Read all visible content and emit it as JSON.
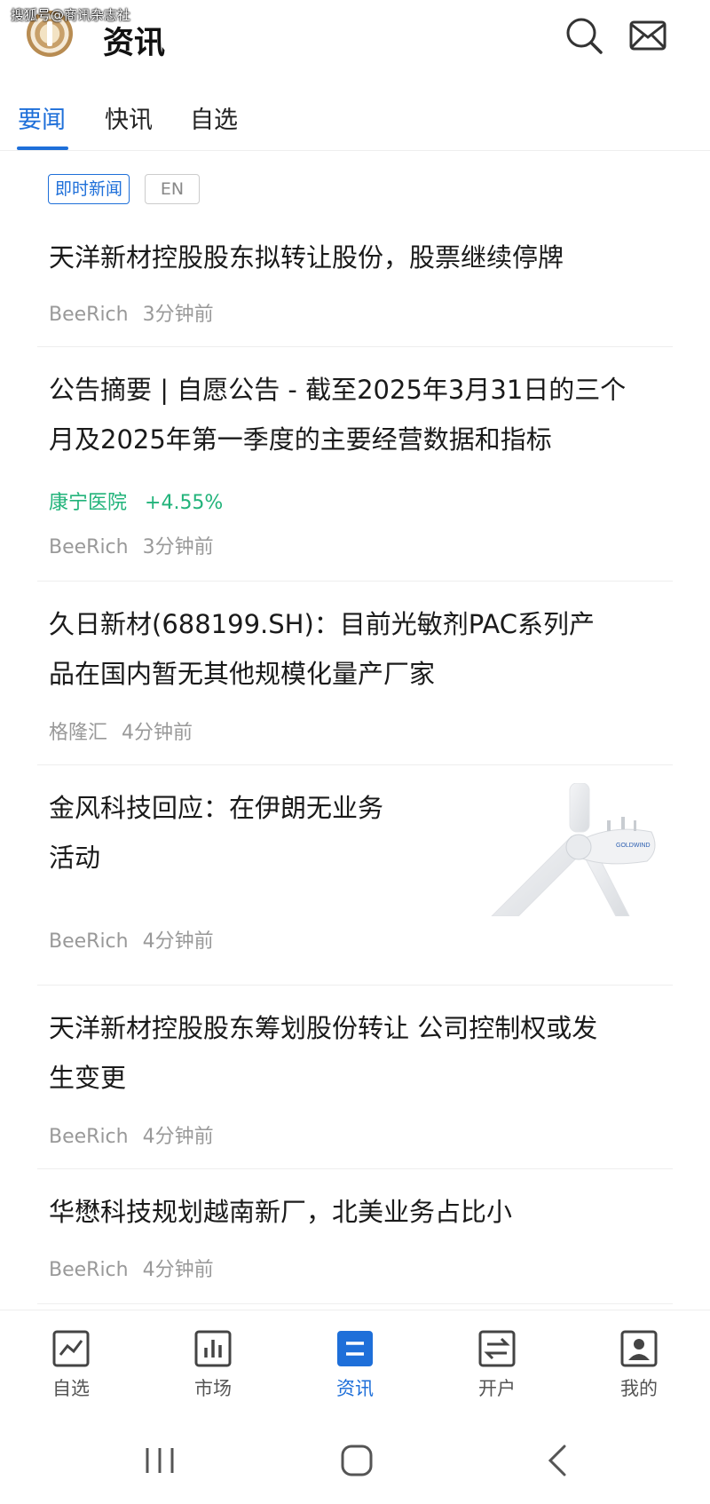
{
  "watermark": "搜狐号@商讯杂志社",
  "header": {
    "title": "资讯",
    "search_icon": "search-icon",
    "mail_icon": "mail-icon"
  },
  "tabs": [
    {
      "label": "要闻",
      "active": true
    },
    {
      "label": "快讯",
      "active": false
    },
    {
      "label": "自选",
      "active": false
    }
  ],
  "chips": {
    "realtime": "即时新闻",
    "english": "EN"
  },
  "news": [
    {
      "title_lines": [
        "天洋新材控股股东拟转让股份，股票继续停牌"
      ],
      "source": "BeeRich",
      "time": "3分钟前"
    },
    {
      "title_lines": [
        "公告摘要 | 自愿公告 - 截至2025年3月31日的三个",
        "月及2025年第一季度的主要经营数据和指标"
      ],
      "stock": {
        "name": "康宁医院",
        "change": "+4.55%"
      },
      "source": "BeeRich",
      "time": "3分钟前"
    },
    {
      "title_lines": [
        "久日新材(688199.SH)：目前光敏剂PAC系列产",
        "品在国内暂无其他规模化量产厂家"
      ],
      "source": "格隆汇",
      "time": "4分钟前"
    },
    {
      "title_lines": [
        "金风科技回应：在伊朗无业务",
        "活动"
      ],
      "source": "BeeRich",
      "time": "4分钟前",
      "image_label": "GOLDWIND"
    },
    {
      "title_lines": [
        "天洋新材控股股东筹划股份转让 公司控制权或发",
        "生变更"
      ],
      "source": "BeeRich",
      "time": "4分钟前"
    },
    {
      "title_lines": [
        "华懋科技规划越南新厂，北美业务占比小"
      ],
      "source": "BeeRich",
      "time": "4分钟前"
    }
  ],
  "bottom_nav": [
    {
      "label": "自选",
      "icon": "chart-line-icon",
      "active": false
    },
    {
      "label": "市场",
      "icon": "bar-chart-icon",
      "active": false
    },
    {
      "label": "资讯",
      "icon": "news-icon",
      "active": true
    },
    {
      "label": "开户",
      "icon": "exchange-icon",
      "active": false
    },
    {
      "label": "我的",
      "icon": "profile-icon",
      "active": false
    }
  ],
  "colors": {
    "accent": "#1e6fd9",
    "stock_up": "#21b37a",
    "meta": "#999999"
  }
}
